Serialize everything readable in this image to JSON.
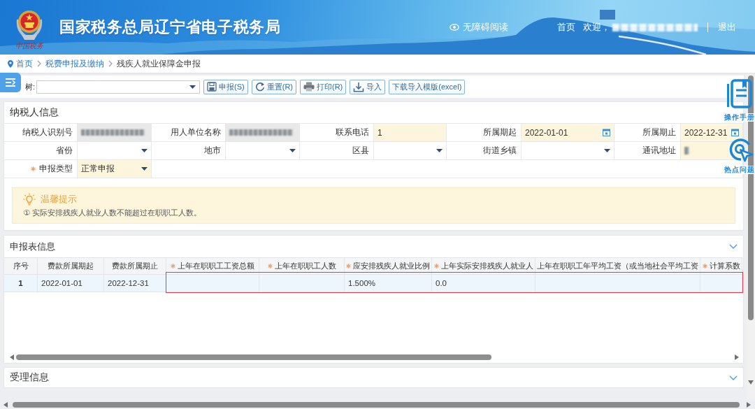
{
  "header": {
    "logo_caption": "中国税务",
    "title": "国家税务总局辽宁省电子税务局",
    "accessibility_link": "无障碍阅读",
    "home_link": "首页",
    "greeting": "欢迎，",
    "user_masked": true,
    "logout_link": "退出"
  },
  "breadcrumb": [
    {
      "label": "首页",
      "kind": "link"
    },
    {
      "label": "税费申报及缴纳",
      "kind": "link"
    },
    {
      "label": "残疾人就业保障金申报",
      "kind": "current"
    }
  ],
  "toolbar": {
    "tree_label": "树:",
    "buttons": [
      {
        "kind": "save",
        "label": "申报(S)"
      },
      {
        "kind": "reset",
        "label": "重置(R)"
      },
      {
        "kind": "print",
        "label": "打印(R)"
      },
      {
        "kind": "import",
        "label": "导入"
      },
      {
        "kind": "plain",
        "label": "下载导入模版(excel)"
      }
    ]
  },
  "side_tools": [
    {
      "kind": "manual",
      "label": "操作手册"
    },
    {
      "kind": "hotspot",
      "label": "热点问题"
    }
  ],
  "taxpayer_info": {
    "title": "纳税人信息",
    "fields": [
      {
        "label": "纳税人识别号",
        "kind": "readonly",
        "masked": true,
        "highlight": false,
        "required": false
      },
      {
        "label": "用人单位名称",
        "kind": "readonly",
        "masked": true,
        "highlight": false,
        "required": false
      },
      {
        "label": "联系电话",
        "kind": "input",
        "value": "1",
        "masked": false,
        "highlight": true,
        "required": false
      },
      {
        "label": "所属期起",
        "kind": "date",
        "value": "2022-01-01",
        "masked": false,
        "highlight": true,
        "required": false
      },
      {
        "label": "所属期止",
        "kind": "date",
        "value": "2022-12-31",
        "masked": false,
        "highlight": true,
        "required": false
      },
      {
        "label": "省份",
        "kind": "select",
        "masked": false,
        "highlight": false,
        "required": false
      },
      {
        "label": "地市",
        "kind": "select",
        "masked": false,
        "highlight": false,
        "required": false
      },
      {
        "label": "区县",
        "kind": "select",
        "masked": false,
        "highlight": false,
        "required": false
      },
      {
        "label": "街道乡镇",
        "kind": "select",
        "masked": false,
        "highlight": false,
        "required": false
      },
      {
        "label": "通讯地址",
        "kind": "input",
        "masked": true,
        "highlight": true,
        "required": false
      },
      {
        "label": "申报类型",
        "kind": "select",
        "value": "正常申报",
        "masked": false,
        "highlight": true,
        "required": true
      }
    ],
    "tip": {
      "title": "温馨提示",
      "text": "① 实际安排残疾人就业人数不能超过在职职工人数。"
    }
  },
  "report": {
    "title": "申报表信息",
    "columns": [
      {
        "label": "序号",
        "required": false,
        "framed": false
      },
      {
        "label": "费款所属期起",
        "required": false,
        "framed": false
      },
      {
        "label": "费款所属期止",
        "required": false,
        "framed": false
      },
      {
        "label": "上年在职职工工资总额",
        "required": true,
        "framed": true
      },
      {
        "label": "上年在职职工人数",
        "required": true,
        "framed": true
      },
      {
        "label": "应安排残疾人就业比例",
        "required": true,
        "framed": true
      },
      {
        "label": "上年实际安排残疾人就业人",
        "required": true,
        "framed": true
      },
      {
        "label": "上年在职职工年平均工资（或当地社会平均工资",
        "required": false,
        "framed": true
      },
      {
        "label": "计算系数",
        "required": true,
        "framed": true
      }
    ],
    "rows": [
      {
        "cells": [
          "1",
          "2022-01-01",
          "2022-12-31",
          null,
          null,
          "1.500%",
          "0.0",
          null,
          null
        ]
      }
    ]
  },
  "acceptance": {
    "title": "受理信息"
  }
}
